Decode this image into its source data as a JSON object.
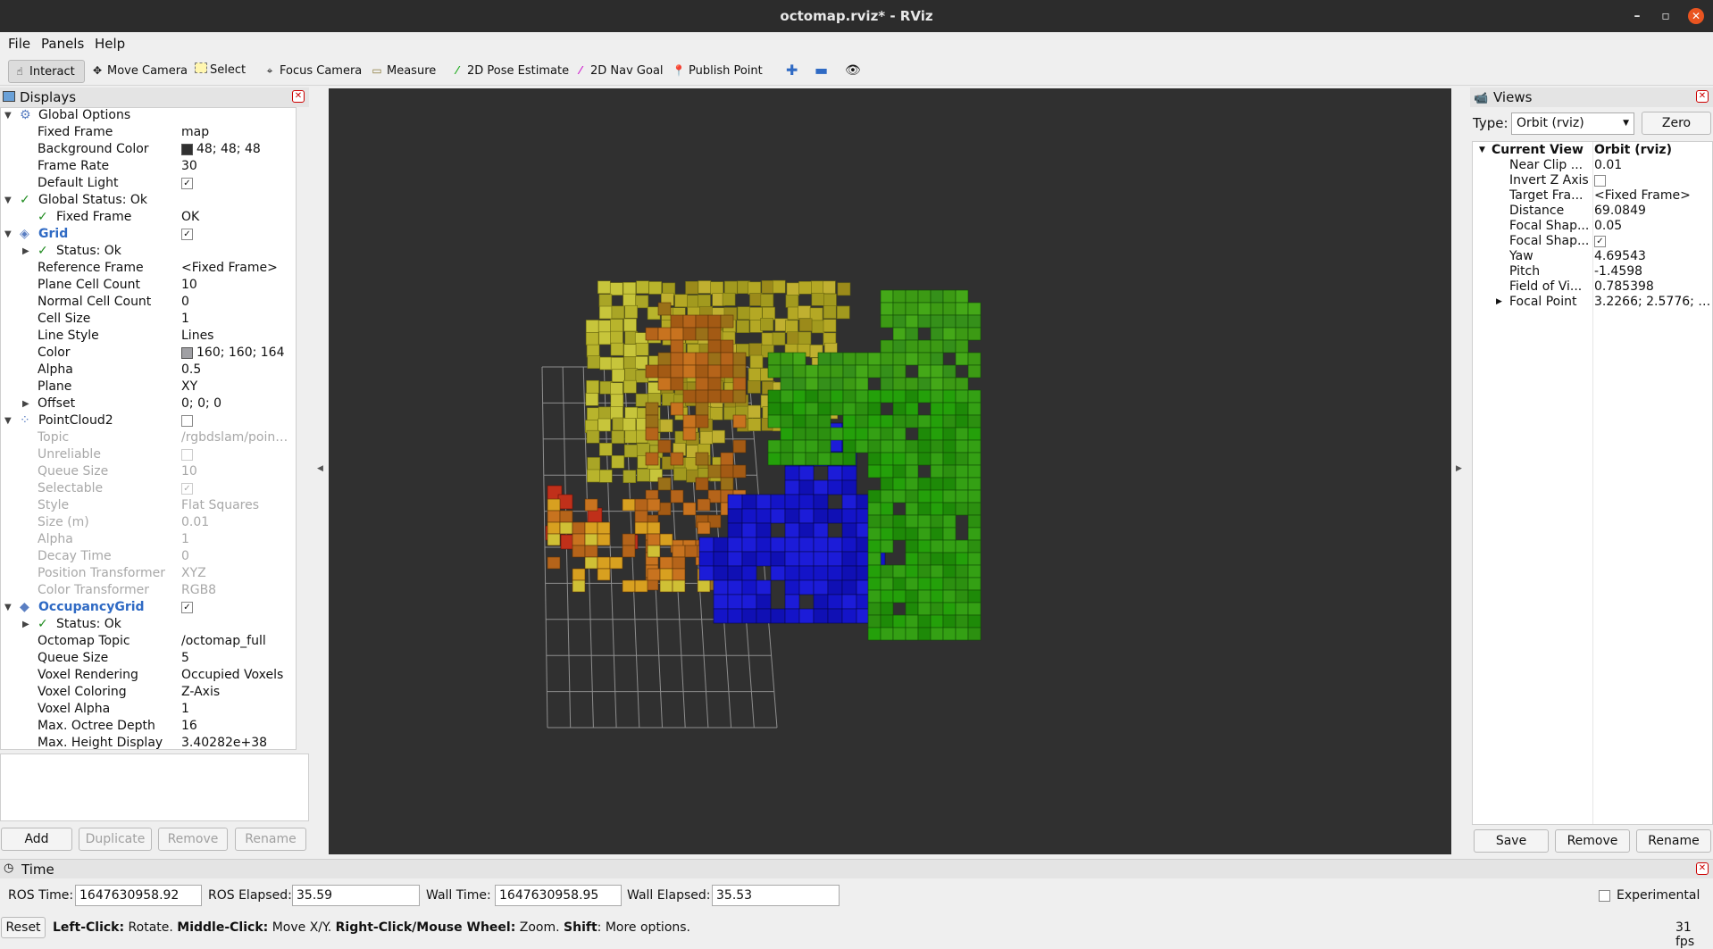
{
  "window": {
    "title": "octomap.rviz* - RViz"
  },
  "menu": [
    "File",
    "Panels",
    "Help"
  ],
  "toolbar": {
    "interact": "Interact",
    "move_camera": "Move Camera",
    "select": "Select",
    "focus_camera": "Focus Camera",
    "measure": "Measure",
    "pose_estimate": "2D Pose Estimate",
    "nav_goal": "2D Nav Goal",
    "publish_point": "Publish Point"
  },
  "displays": {
    "title": "Displays",
    "rows": {
      "global_options": "Global Options",
      "fixed_frame": "Fixed Frame",
      "fixed_frame_val": "map",
      "bg_color": "Background Color",
      "bg_color_val": "48; 48; 48",
      "frame_rate": "Frame Rate",
      "frame_rate_val": "30",
      "default_light": "Default Light",
      "global_status": "Global Status: Ok",
      "gs_fixed_frame": "Fixed Frame",
      "gs_fixed_frame_val": "OK",
      "grid": "Grid",
      "grid_status": "Status: Ok",
      "ref_frame": "Reference Frame",
      "ref_frame_val": "<Fixed Frame>",
      "plane_cell_count": "Plane Cell Count",
      "plane_cell_count_val": "10",
      "normal_cell_count": "Normal Cell Count",
      "normal_cell_count_val": "0",
      "cell_size": "Cell Size",
      "cell_size_val": "1",
      "line_style": "Line Style",
      "line_style_val": "Lines",
      "color": "Color",
      "color_val": "160; 160; 164",
      "alpha": "Alpha",
      "alpha_val": "0.5",
      "plane": "Plane",
      "plane_val": "XY",
      "offset": "Offset",
      "offset_val": "0; 0; 0",
      "pointcloud2": "PointCloud2",
      "topic": "Topic",
      "topic_val": "/rgbdslam/poin…",
      "unreliable": "Unreliable",
      "queue_size": "Queue Size",
      "queue_size_val": "10",
      "selectable": "Selectable",
      "style": "Style",
      "style_val": "Flat Squares",
      "size_m": "Size (m)",
      "size_m_val": "0.01",
      "pc_alpha": "Alpha",
      "pc_alpha_val": "1",
      "decay_time": "Decay Time",
      "decay_time_val": "0",
      "pos_transformer": "Position Transformer",
      "pos_transformer_val": "XYZ",
      "color_transformer": "Color Transformer",
      "color_transformer_val": "RGB8",
      "occupancy_grid": "OccupancyGrid",
      "og_status": "Status: Ok",
      "octomap_topic": "Octomap Topic",
      "octomap_topic_val": "/octomap_full",
      "og_queue_size": "Queue Size",
      "og_queue_size_val": "5",
      "voxel_rendering": "Voxel Rendering",
      "voxel_rendering_val": "Occupied Voxels",
      "voxel_coloring": "Voxel Coloring",
      "voxel_coloring_val": "Z-Axis",
      "voxel_alpha": "Voxel Alpha",
      "voxel_alpha_val": "1",
      "max_depth": "Max. Octree Depth",
      "max_depth_val": "16",
      "max_height": "Max. Height Display",
      "max_height_val": "3.40282e+38"
    },
    "buttons": {
      "add": "Add",
      "duplicate": "Duplicate",
      "remove": "Remove",
      "rename": "Rename"
    }
  },
  "views": {
    "title": "Views",
    "type_label": "Type:",
    "type_value": "Orbit (rviz)",
    "zero": "Zero",
    "current_view": "Current View",
    "current_view_val": "Orbit (rviz)",
    "rows": [
      {
        "label": "Near Clip ...",
        "value": "0.01"
      },
      {
        "label": "Invert Z Axis",
        "value": ""
      },
      {
        "label": "Target Fra...",
        "value": "<Fixed Frame>"
      },
      {
        "label": "Distance",
        "value": "69.0849"
      },
      {
        "label": "Focal Shap...",
        "value": "0.05"
      },
      {
        "label": "Focal Shap...",
        "value": ""
      },
      {
        "label": "Yaw",
        "value": "4.69543"
      },
      {
        "label": "Pitch",
        "value": "-1.4598"
      },
      {
        "label": "Field of Vi...",
        "value": "0.785398"
      },
      {
        "label": "Focal Point",
        "value": "3.2266; 2.5776; …"
      }
    ],
    "buttons": {
      "save": "Save",
      "remove": "Remove",
      "rename": "Rename"
    }
  },
  "time": {
    "title": "Time",
    "ros_time_label": "ROS Time:",
    "ros_time": "1647630958.92",
    "ros_elapsed_label": "ROS Elapsed:",
    "ros_elapsed": "35.59",
    "wall_time_label": "Wall Time:",
    "wall_time": "1647630958.95",
    "wall_elapsed_label": "Wall Elapsed:",
    "wall_elapsed": "35.53",
    "experimental": "Experimental"
  },
  "status": {
    "reset": "Reset",
    "left_click": "Left-Click:",
    "rotate": " Rotate. ",
    "middle_click": "Middle-Click:",
    "move": " Move X/Y. ",
    "right_click": "Right-Click/Mouse Wheel:",
    "zoom": " Zoom. ",
    "shift": "Shift",
    "more": ": More options.",
    "fps": "31 fps"
  },
  "colors": {
    "viewport_bg": "#303030",
    "bg_swatch": "#303030",
    "grid_swatch": "#a0a0a4"
  }
}
